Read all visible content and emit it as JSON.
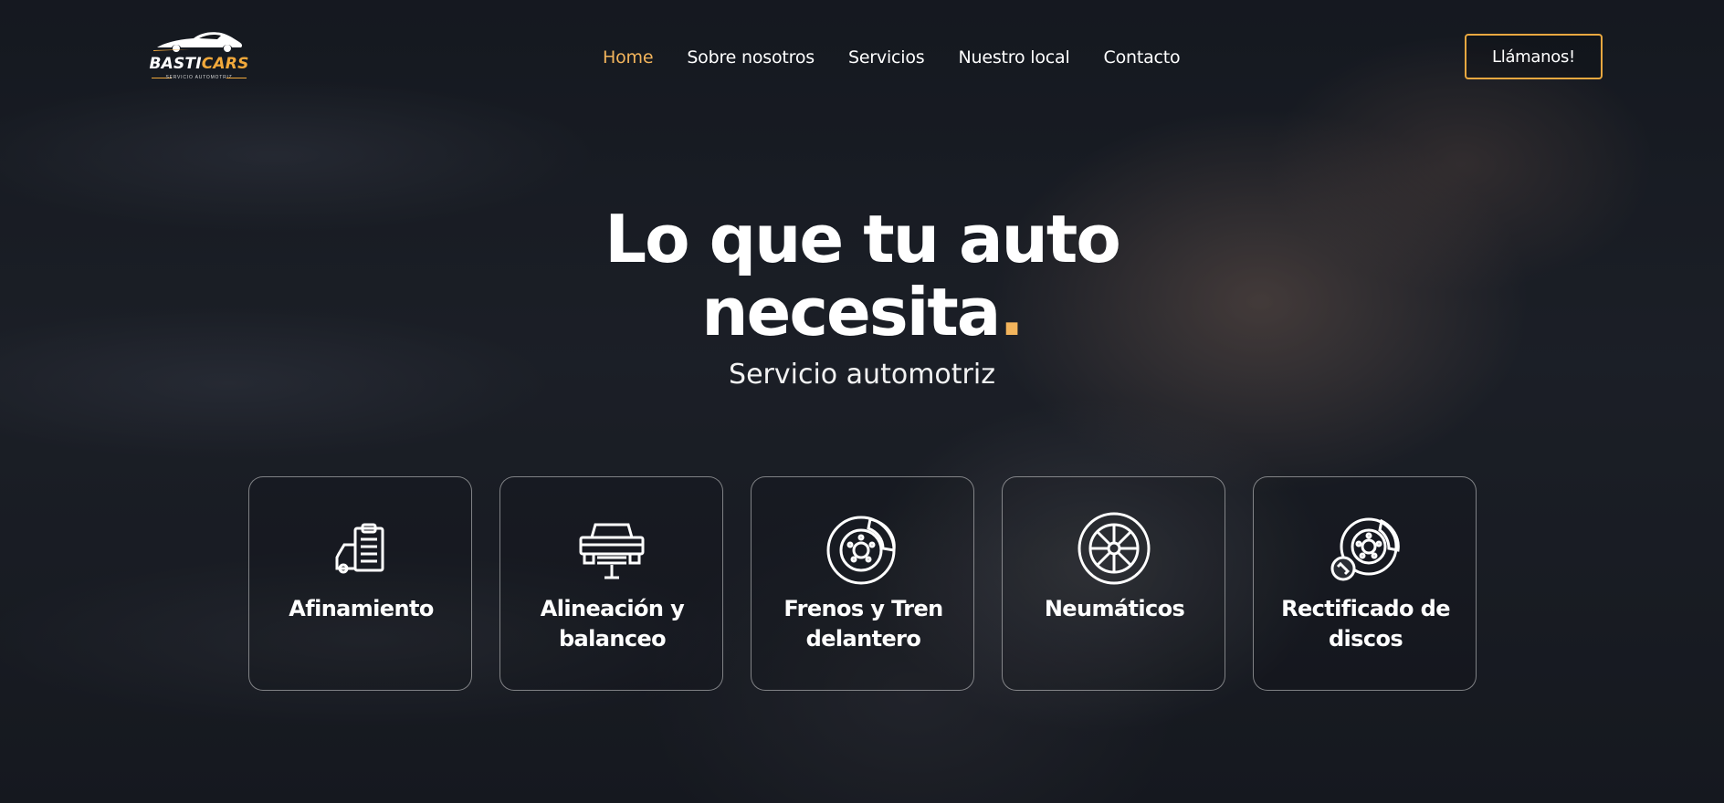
{
  "brand": {
    "name_part1": "BASTI",
    "name_part2": "CARS",
    "tagline": "SERVICIO AUTOMOTRIZ",
    "accent_color": "#f2a93b"
  },
  "nav": {
    "items": [
      {
        "label": "Home",
        "active": true
      },
      {
        "label": "Sobre nosotros",
        "active": false
      },
      {
        "label": "Servicios",
        "active": false
      },
      {
        "label": "Nuestro local",
        "active": false
      },
      {
        "label": "Contacto",
        "active": false
      }
    ],
    "active_color": "#f2b45c"
  },
  "cta": {
    "label": "Llámanos!",
    "border_color": "#e9a840"
  },
  "hero": {
    "title_line1": "Lo que tu auto",
    "title_line2": "necesita",
    "title_dot": ".",
    "subtitle": "Servicio automotriz",
    "background_icon": "mechanic-hands-wrench-photo"
  },
  "services": [
    {
      "label": "Afinamiento",
      "icon": "car-checklist-icon"
    },
    {
      "label": "Alineación y balanceo",
      "icon": "car-lift-icon"
    },
    {
      "label": "Frenos y Tren delantero",
      "icon": "brake-disc-icon"
    },
    {
      "label": "Neumáticos",
      "icon": "tire-wheel-icon"
    },
    {
      "label": "Rectificado de discos",
      "icon": "disc-wrench-icon"
    }
  ]
}
